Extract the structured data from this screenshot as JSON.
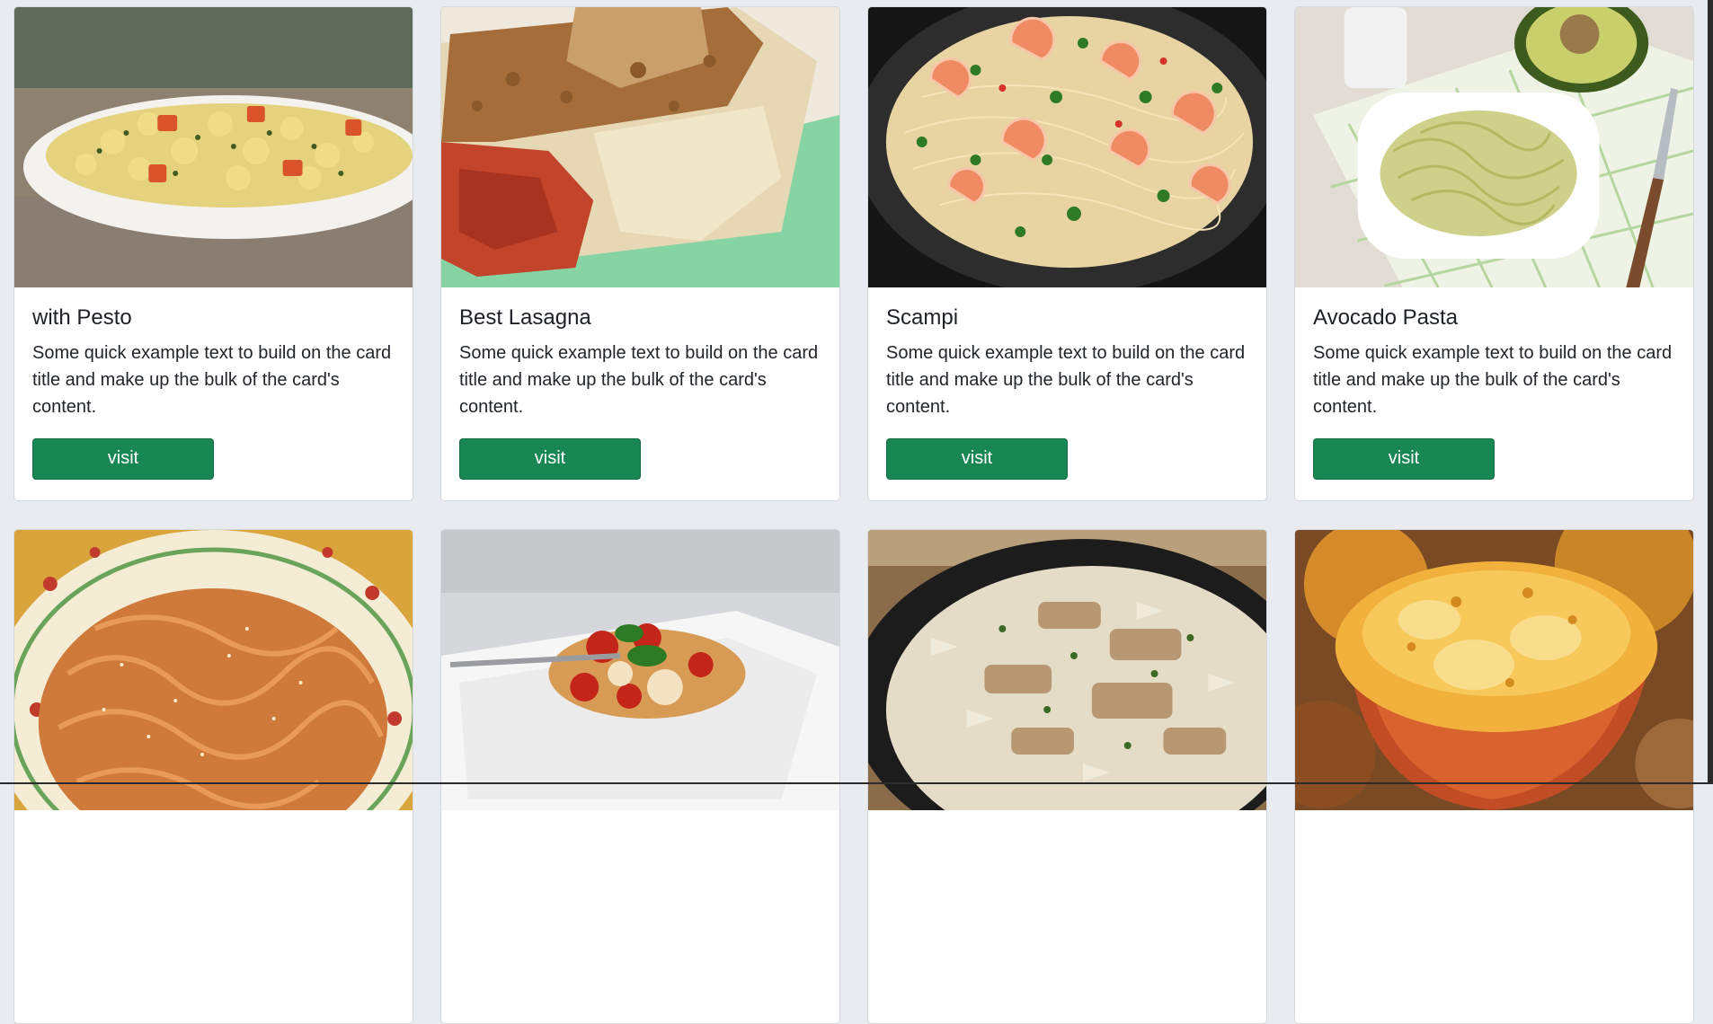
{
  "cards": [
    {
      "title": "with Pesto",
      "text": "Some quick example text to build on the card title and make up the bulk of the card's content.",
      "button_label": "visit",
      "image": "pasta-salad-pesto",
      "colors": {
        "bg": "#9a8c7a",
        "plate": "#f4f2ee",
        "food": "#e8d27a",
        "accent": "#d9542b",
        "herb": "#4f6b2a"
      }
    },
    {
      "title": "Best Lasagna",
      "text": "Some quick example text to build on the card title and make up the bulk of the card's content.",
      "button_label": "visit",
      "image": "lasagna",
      "colors": {
        "bg": "#f1ece3",
        "plate": "#7fcfa0",
        "food": "#b77d48",
        "accent": "#c2442a",
        "herb": "#e9dfc4"
      }
    },
    {
      "title": "Scampi",
      "text": "Some quick example text to build on the card title and make up the bulk of the card's content.",
      "button_label": "visit",
      "image": "shrimp-scampi",
      "colors": {
        "bg": "#1f1f1f",
        "plate": "#2c2c2c",
        "food": "#e9d6a6",
        "accent": "#f08058",
        "herb": "#2f7a24"
      }
    },
    {
      "title": "Avocado Pasta",
      "text": "Some quick example text to build on the card title and make up the bulk of the card's content.",
      "button_label": "visit",
      "image": "avocado-pasta",
      "colors": {
        "bg": "#e4dfd6",
        "plate": "#ffffff",
        "food": "#c9c77a",
        "accent": "#5b7b24",
        "herb": "#a6c98d"
      }
    },
    {
      "title": "",
      "text": "",
      "button_label": "",
      "image": "pappardelle",
      "colors": {
        "bg": "#d9a43b",
        "plate": "#f6f0dd",
        "food": "#d07a38",
        "accent": "#c23a2b",
        "herb": "#f1e2b8"
      }
    },
    {
      "title": "",
      "text": "",
      "button_label": "",
      "image": "caprese-pasta",
      "colors": {
        "bg": "#d2d4d8",
        "plate": "#f5f5f5",
        "food": "#d89b55",
        "accent": "#c4251a",
        "herb": "#2d7a24"
      }
    },
    {
      "title": "",
      "text": "",
      "button_label": "",
      "image": "chicken-bowtie",
      "colors": {
        "bg": "#8a6b4a",
        "plate": "#1c1c1c",
        "food": "#e4dcc6",
        "accent": "#b79873",
        "herb": "#3c6a25"
      }
    },
    {
      "title": "",
      "text": "",
      "button_label": "",
      "image": "mac-cheese-cup",
      "colors": {
        "bg": "#b8862c",
        "plate": "#c24d25",
        "food": "#f2b13d",
        "accent": "#f7dd8c",
        "herb": "#8d4a20"
      }
    }
  ]
}
